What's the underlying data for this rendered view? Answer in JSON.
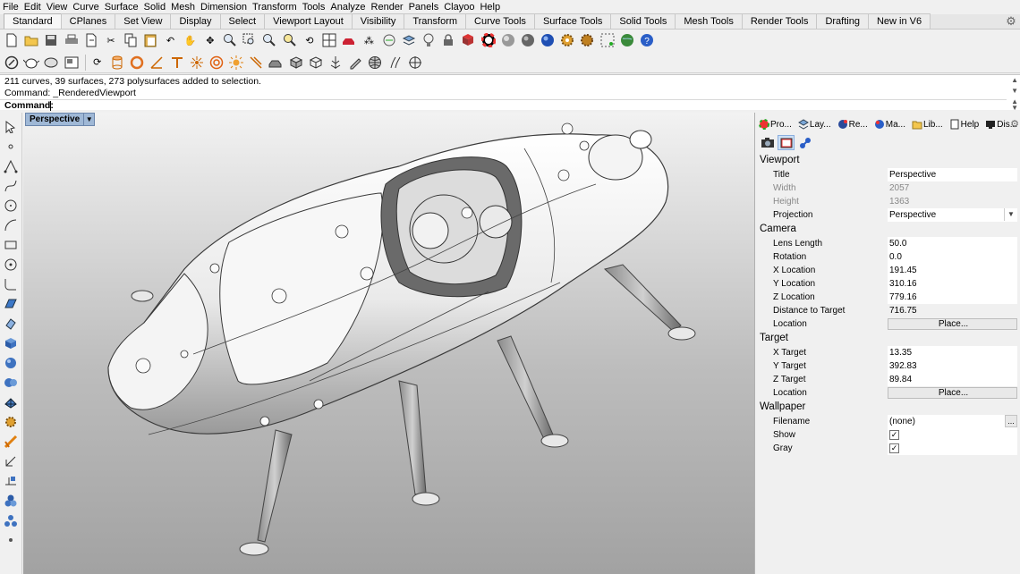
{
  "menu": [
    "File",
    "Edit",
    "View",
    "Curve",
    "Surface",
    "Solid",
    "Mesh",
    "Dimension",
    "Transform",
    "Tools",
    "Analyze",
    "Render",
    "Panels",
    "Clayoo",
    "Help"
  ],
  "tabs": [
    "Standard",
    "CPlanes",
    "Set View",
    "Display",
    "Select",
    "Viewport Layout",
    "Visibility",
    "Transform",
    "Curve Tools",
    "Surface Tools",
    "Solid Tools",
    "Mesh Tools",
    "Render Tools",
    "Drafting",
    "New in V6"
  ],
  "active_tab": "Standard",
  "toolbar1_icons": [
    "new-icon",
    "open-icon",
    "save-icon",
    "print-icon",
    "import-icon",
    "cut-icon",
    "copy-icon",
    "paste-icon",
    "undo-icon",
    "pan-hand-icon",
    "move-view-icon",
    "zoom-icon",
    "zoom-window-icon",
    "zoom-extents-icon",
    "zoom-selected-icon",
    "rotate-view-icon",
    "four-viewports-icon",
    "car-icon",
    "grid-snap-icon",
    "cplane-icon",
    "layer-icon",
    "light-bulb-icon",
    "lock-icon",
    "material-icon",
    "color-wheel-icon",
    "sphere-render-icon",
    "sphere-shade-icon",
    "sphere-blue-icon",
    "settings-gear-icon",
    "options-icon",
    "grid-dots-icon",
    "globe-icon",
    "help-icon"
  ],
  "toolbar2_icons": [
    "osnap-icon",
    "teapot-icon",
    "hide-icon",
    "layout-icon",
    "rotate-icon",
    "cylinder-icon",
    "ring-icon",
    "angle-icon",
    "ttool-icon",
    "sun-burst-icon",
    "target-icon",
    "sun-icon",
    "line-tool-icon",
    "car-view-icon",
    "box-icon",
    "box-outline-icon",
    "tree-icon",
    "pen-icon",
    "mesh-sphere-icon",
    "wire-icon",
    "crosshair-icon"
  ],
  "command_history": [
    "211 curves, 39 surfaces, 273 polysurfaces added to selection.",
    "Command: _RenderedViewport"
  ],
  "command_prompt": "Command:",
  "viewport_label": "Perspective",
  "panel_tabs": [
    {
      "label": "Pro...",
      "icon": "properties-icon"
    },
    {
      "label": "Lay...",
      "icon": "layers-icon"
    },
    {
      "label": "Re...",
      "icon": "render-icon"
    },
    {
      "label": "Ma...",
      "icon": "materials-icon"
    },
    {
      "label": "Lib...",
      "icon": "libraries-icon"
    },
    {
      "label": "Help",
      "icon": "help-book-icon"
    },
    {
      "label": "Dis...",
      "icon": "display-icon"
    }
  ],
  "viewport_props": {
    "title": "Viewport",
    "rows": [
      {
        "key": "Title",
        "value": "Perspective"
      },
      {
        "key": "Width",
        "value": "2057"
      },
      {
        "key": "Height",
        "value": "1363"
      },
      {
        "key": "Projection",
        "value": "Perspective"
      }
    ]
  },
  "camera": {
    "title": "Camera",
    "rows": [
      {
        "key": "Lens Length",
        "value": "50.0"
      },
      {
        "key": "Rotation",
        "value": "0.0"
      },
      {
        "key": "X Location",
        "value": "191.45"
      },
      {
        "key": "Y Location",
        "value": "310.16"
      },
      {
        "key": "Z Location",
        "value": "779.16"
      },
      {
        "key": "Distance to Target",
        "value": "716.75"
      },
      {
        "key": "Location",
        "value": "Place..."
      }
    ]
  },
  "target": {
    "title": "Target",
    "rows": [
      {
        "key": "X Target",
        "value": "13.35"
      },
      {
        "key": "Y Target",
        "value": "392.83"
      },
      {
        "key": "Z Target",
        "value": "89.84"
      },
      {
        "key": "Location",
        "value": "Place..."
      }
    ]
  },
  "wallpaper": {
    "title": "Wallpaper",
    "rows": [
      {
        "key": "Filename",
        "value": "(none)"
      },
      {
        "key": "Show",
        "value": "✓"
      },
      {
        "key": "Gray",
        "value": "✓"
      }
    ]
  },
  "ellipsis": "..."
}
